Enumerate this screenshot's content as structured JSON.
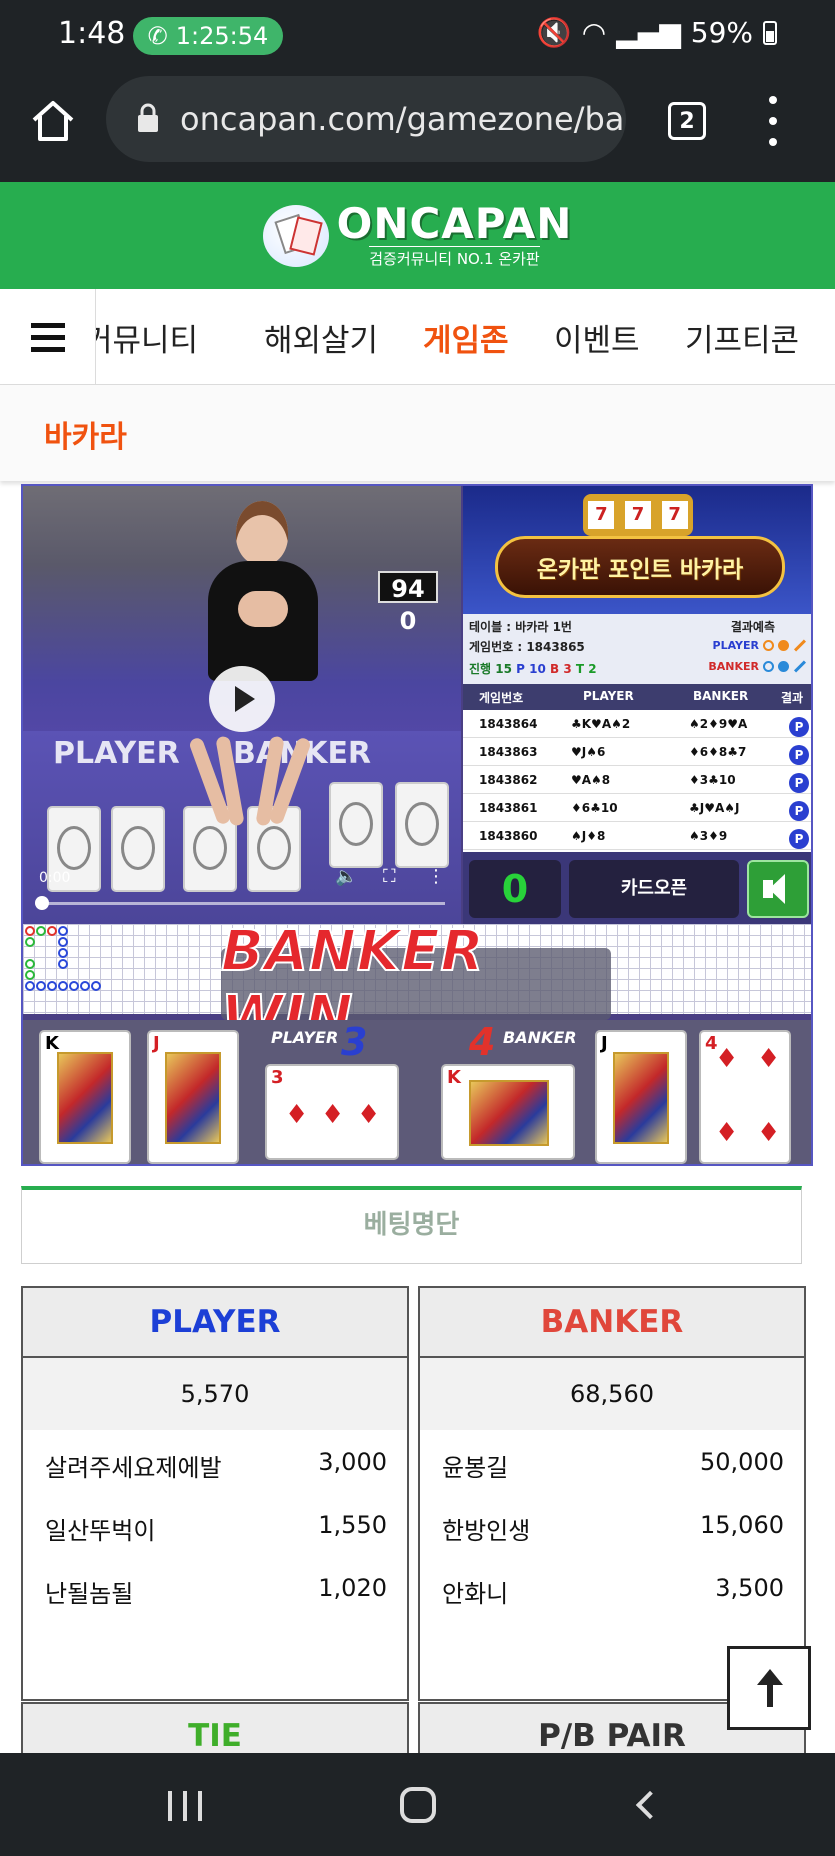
{
  "status_bar": {
    "time": "1:48",
    "call_timer": "1:25:54",
    "battery": "59%"
  },
  "browser": {
    "url": "oncapan.com/gamezone/ba",
    "tab_count": "2"
  },
  "site": {
    "logo_text": "ONCAPAN",
    "logo_sub": "검증커뮤니티 NO.1 온카판",
    "brand_color": "#27ad4f"
  },
  "nav": {
    "items": [
      {
        "label": "커뮤니티"
      },
      {
        "label": "해외살기"
      },
      {
        "label": "게임존"
      },
      {
        "label": "이벤트"
      },
      {
        "label": "기프티콘"
      }
    ],
    "active_index": 2,
    "active_color": "#f0520f"
  },
  "subnav": {
    "label": "바카라"
  },
  "game": {
    "video": {
      "counter": "94 0",
      "time": "0:00",
      "felt_left": "PLAYER",
      "felt_right": "BANKER"
    },
    "promo_title": "온카판 포인트 바카라",
    "slot_digits": [
      "7",
      "7",
      "7"
    ],
    "info": {
      "table": "테이블 : 바카라 1번",
      "game_no": "게임번호 : 1843865",
      "progress": "진행 15",
      "p_count": "P 10",
      "b_count": "B 3",
      "t_count": "T 2",
      "prediction_label": "결과예측",
      "pred_player": "PLAYER",
      "pred_banker": "BANKER"
    },
    "history_headers": [
      "게임번호",
      "PLAYER",
      "BANKER",
      "결과"
    ],
    "history": [
      {
        "no": "1843864",
        "player": "♣K♥A♠2",
        "banker": "♠2♦9♥A",
        "result": "P"
      },
      {
        "no": "1843863",
        "player": "♥J♠6",
        "banker": "♦6♦8♣7",
        "result": "P"
      },
      {
        "no": "1843862",
        "player": "♥A♠8",
        "banker": "♦3♣10",
        "result": "P"
      },
      {
        "no": "1843861",
        "player": "♦6♣10",
        "banker": "♣J♥A♠J",
        "result": "P"
      },
      {
        "no": "1843860",
        "player": "♠J♦8",
        "banker": "♠3♦9",
        "result": "P"
      }
    ],
    "score_display": "0",
    "card_open_label": "카드오픈",
    "win_banner": "BANKER WIN",
    "player_label": "PLAYER",
    "player_score": "3",
    "banker_label": "BANKER",
    "banker_score": "4",
    "player_cards": [
      "K",
      "J",
      "3"
    ],
    "banker_cards": [
      "K",
      "J",
      "4"
    ]
  },
  "betting": {
    "title": "베팅명단",
    "player": {
      "label": "PLAYER",
      "color": "#1c3fd6",
      "total": "5,570",
      "rows": [
        {
          "name": "살려주세요제에발",
          "amount": "3,000"
        },
        {
          "name": "일산뚜벅이",
          "amount": "1,550"
        },
        {
          "name": "난될놈될",
          "amount": "1,020"
        }
      ]
    },
    "banker": {
      "label": "BANKER",
      "color": "#e0473b",
      "total": "68,560",
      "rows": [
        {
          "name": "윤봉길",
          "amount": "50,000"
        },
        {
          "name": "한방인생",
          "amount": "15,060"
        },
        {
          "name": "안화니",
          "amount": "3,500"
        }
      ]
    },
    "tie_label": "TIE",
    "tie_color": "#3fae2a",
    "pair_label": "P/B PAIR"
  }
}
